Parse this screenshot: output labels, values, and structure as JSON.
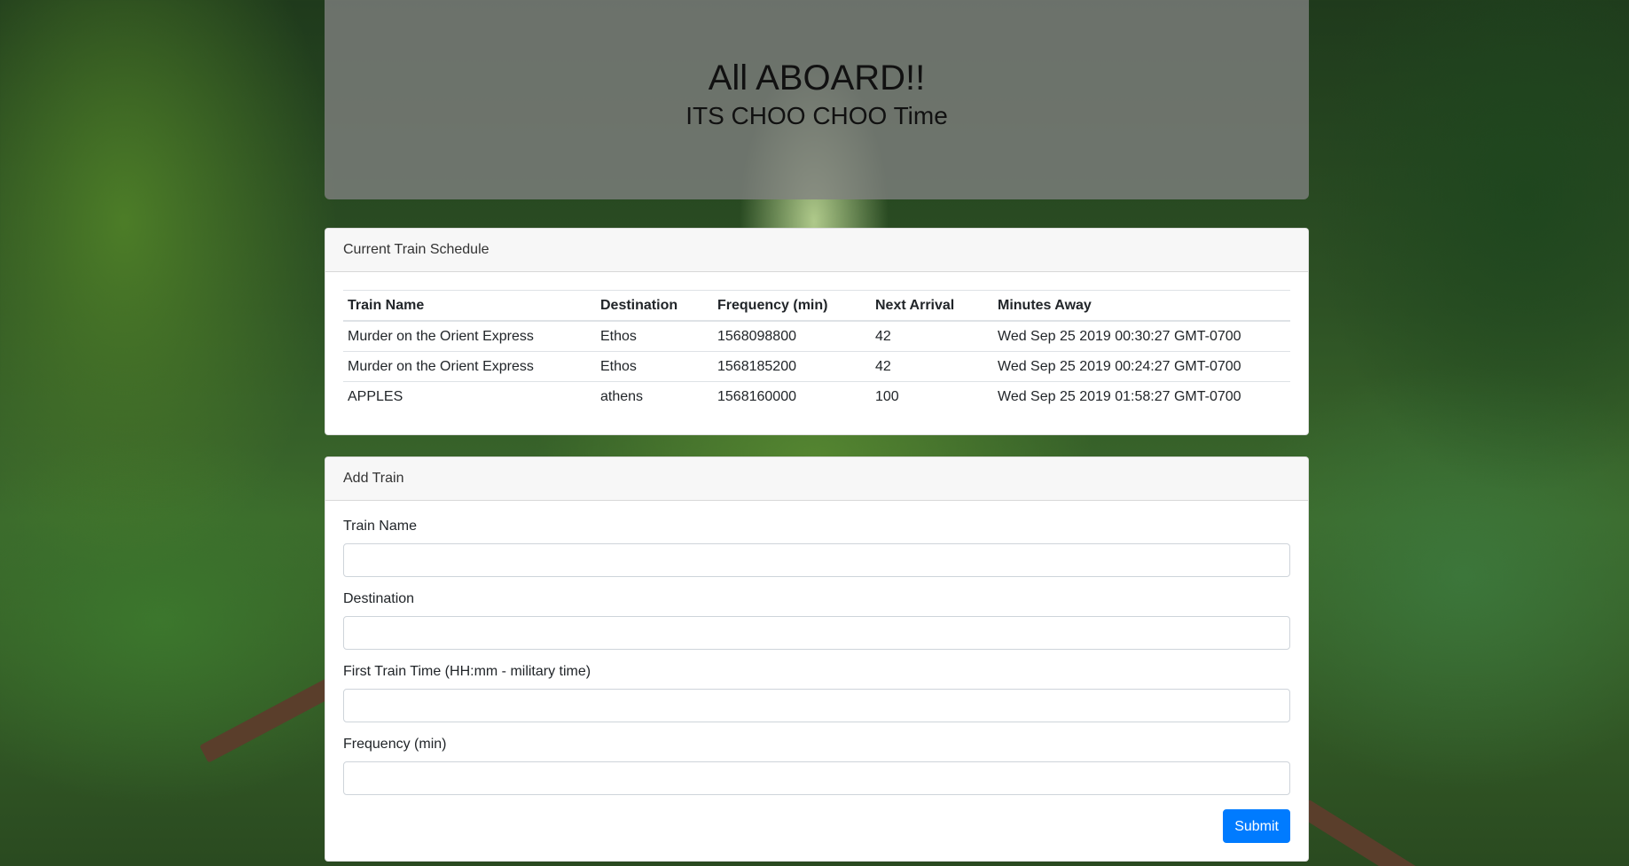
{
  "header": {
    "title": "All ABOARD!!",
    "subtitle": "ITS CHOO CHOO Time"
  },
  "schedule": {
    "card_title": "Current Train Schedule",
    "columns": [
      "Train Name",
      "Destination",
      "Frequency (min)",
      "Next Arrival",
      "Minutes Away"
    ],
    "rows": [
      [
        "Murder on the Orient Express",
        "Ethos",
        "1568098800",
        "42",
        "Wed Sep 25 2019 00:30:27 GMT-0700"
      ],
      [
        "Murder on the Orient Express",
        "Ethos",
        "1568185200",
        "42",
        "Wed Sep 25 2019 00:24:27 GMT-0700"
      ],
      [
        "APPLES",
        "athens",
        "1568160000",
        "100",
        "Wed Sep 25 2019 01:58:27 GMT-0700"
      ]
    ]
  },
  "form": {
    "card_title": "Add Train",
    "train_name_label": "Train Name",
    "train_name_value": "",
    "destination_label": "Destination",
    "destination_value": "",
    "first_time_label": "First Train Time (HH:mm - military time)",
    "first_time_value": "",
    "frequency_label": "Frequency (min)",
    "frequency_value": "",
    "submit_label": "Submit"
  },
  "colors": {
    "primary_button": "#007bff",
    "header_overlay": "#828282"
  }
}
